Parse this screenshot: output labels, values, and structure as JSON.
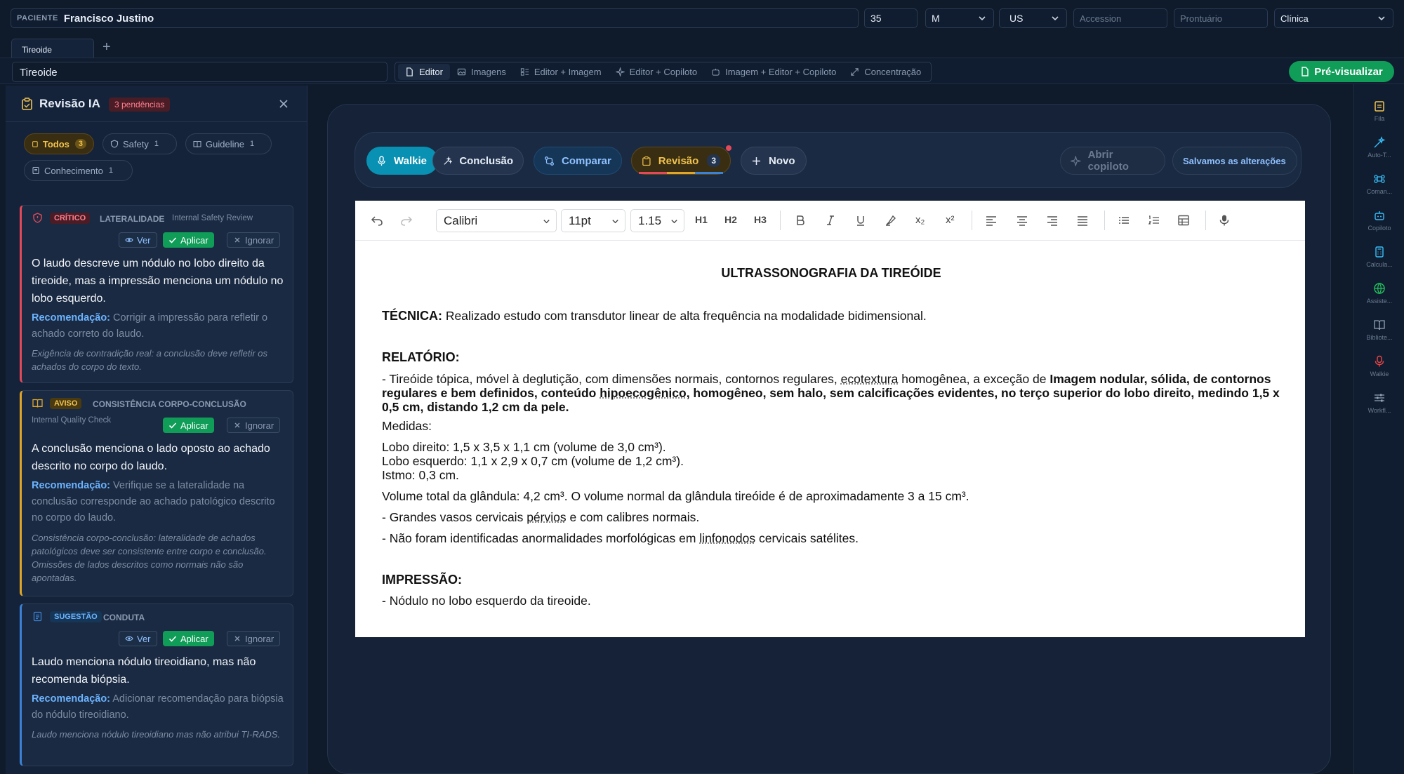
{
  "patient": {
    "label": "PACIENTE",
    "name": "Francisco Justino",
    "age": "35",
    "sex": "M",
    "modality": "US",
    "accession_placeholder": "Accession",
    "record_placeholder": "Prontuário",
    "clinic": "Clínica"
  },
  "tabs": [
    {
      "label": "Tireoide"
    }
  ],
  "toolbar": {
    "title_value": "Tireoide",
    "modes": [
      "Editor",
      "Imagens",
      "Editor + Imagem",
      "Editor + Copiloto",
      "Imagem + Editor + Copiloto",
      "Concentração"
    ],
    "preview_label": "Pré-visualizar"
  },
  "review_panel": {
    "title": "Revisão IA",
    "pending_badge": "3 pendências",
    "filters": [
      {
        "label": "Todos",
        "count": "3"
      },
      {
        "label": "Safety",
        "count": "1"
      },
      {
        "label": "Guideline",
        "count": "1"
      },
      {
        "label": "Conhecimento",
        "count": "1"
      }
    ],
    "actions": {
      "view": "Ver",
      "apply": "Aplicar",
      "ignore": "Ignorar"
    },
    "rec_label": "Recomendação:",
    "cards": [
      {
        "severity": "CRÍTICO",
        "category": "LATERALIDADE",
        "source": "Internal Safety Review",
        "message": "O laudo descreve um nódulo no lobo direito da tireoide, mas a impressão menciona um nódulo no lobo esquerdo.",
        "recommendation": "Corrigir a impressão para refletir o achado correto do laudo.",
        "note": "Exigência de contradição real: a conclusão deve refletir os achados do corpo do texto."
      },
      {
        "severity": "AVISO",
        "category": "CONSISTÊNCIA CORPO-CONCLUSÃO",
        "source": "Internal Quality Check",
        "message": "A conclusão menciona o lado oposto ao achado descrito no corpo do laudo.",
        "recommendation": "Verifique se a lateralidade na conclusão corresponde ao achado patológico descrito no corpo do laudo.",
        "note": "Consistência corpo-conclusão: lateralidade de achados patológicos deve ser consistente entre corpo e conclusão. Omissões de lados descritos como normais não são apontadas."
      },
      {
        "severity": "SUGESTÃO",
        "category": "CONDUTA",
        "source": "",
        "message": "Laudo menciona nódulo tireoidiano, mas não recomenda biópsia.",
        "recommendation": "Adicionar recomendação para biópsia do nódulo tireoidiano.",
        "note": "Laudo menciona nódulo tireoidiano mas não atribui TI-RADS."
      }
    ]
  },
  "actionbar": {
    "walkie": "Walkie",
    "conclusion": "Conclusão",
    "compare": "Comparar",
    "review": "Revisão",
    "review_count": "3",
    "new": "Novo",
    "open_copilot": "Abrir copiloto",
    "saved": "Salvamos as alterações"
  },
  "format_toolbar": {
    "font": "Calibri",
    "size": "11pt",
    "line_height": "1.15",
    "h1": "H1",
    "h2": "H2",
    "h3": "H3",
    "sub": "x₂",
    "sup": "x²"
  },
  "document": {
    "title": "ULTRASSONOGRAFIA DA TIREÓIDE",
    "technique_label": "TÉCNICA:",
    "technique_text": " Realizado estudo com transdutor linear de alta frequência na modalidade bidimensional.",
    "report_label": "RELATÓRIO:",
    "report_p1_a": "- Tireóide tópica, móvel à deglutição, com dimensões normais, contornos regulares, ",
    "report_p1_ul": "ecotextura",
    "report_p1_b": " homogênea, a exceção de ",
    "report_p1_bold_a": "Imagem nodular, sólida, de contornos regulares e bem definidos, conteúdo ",
    "report_p1_bold_ul": "hipoecogênico",
    "report_p1_bold_b": ", homogêneo, sem halo, sem calcificações evidentes, no terço superior do lobo direito, medindo  1,5 x 0,5 cm, distando 1,2 cm da pele.",
    "measures_label": "Medidas:",
    "measure_right": "Lobo direito: 1,5 x 3,5 x 1,1 cm (volume de 3,0 cm³).",
    "measure_left": "Lobo esquerdo: 1,1 x 2,9 x 0,7 cm (volume de 1,2  cm³).",
    "measure_isthmus": "Istmo: 0,3 cm.",
    "volume": "Volume total da glândula: 4,2 cm³. O volume normal da glândula tireóide é de aproximadamente 3 a 15 cm³.",
    "vessels_a": "- Grandes vasos cervicais ",
    "vessels_ul": "pérvios",
    "vessels_b": " e com calibres normais.",
    "nodes_a": "- Não foram identificadas anormalidades morfológicas em ",
    "nodes_ul": "linfonodos",
    "nodes_b": " cervicais satélites.",
    "impression_label": "IMPRESSÃO:",
    "impression_text": "- Nódulo no lobo esquerdo da tireoide."
  },
  "rail": [
    {
      "label": "Fila",
      "icon": "clipboard-icon"
    },
    {
      "label": "Auto-T...",
      "icon": "magic-wand-icon"
    },
    {
      "label": "Coman...",
      "icon": "command-icon"
    },
    {
      "label": "Copiloto",
      "icon": "robot-icon"
    },
    {
      "label": "Calcula...",
      "icon": "calculator-icon"
    },
    {
      "label": "Assiste...",
      "icon": "globe-icon"
    },
    {
      "label": "Bibliote...",
      "icon": "book-icon"
    },
    {
      "label": "Walkie",
      "icon": "mic-icon"
    },
    {
      "label": "Workfl...",
      "icon": "sliders-icon"
    }
  ],
  "colors": {
    "background": "#0f1a2b",
    "accent_green": "#0f9d58",
    "walkie_cyan": "#0891b2",
    "critical": "#e24a5a",
    "warning": "#e0a62a",
    "suggestion": "#3b82d6"
  }
}
